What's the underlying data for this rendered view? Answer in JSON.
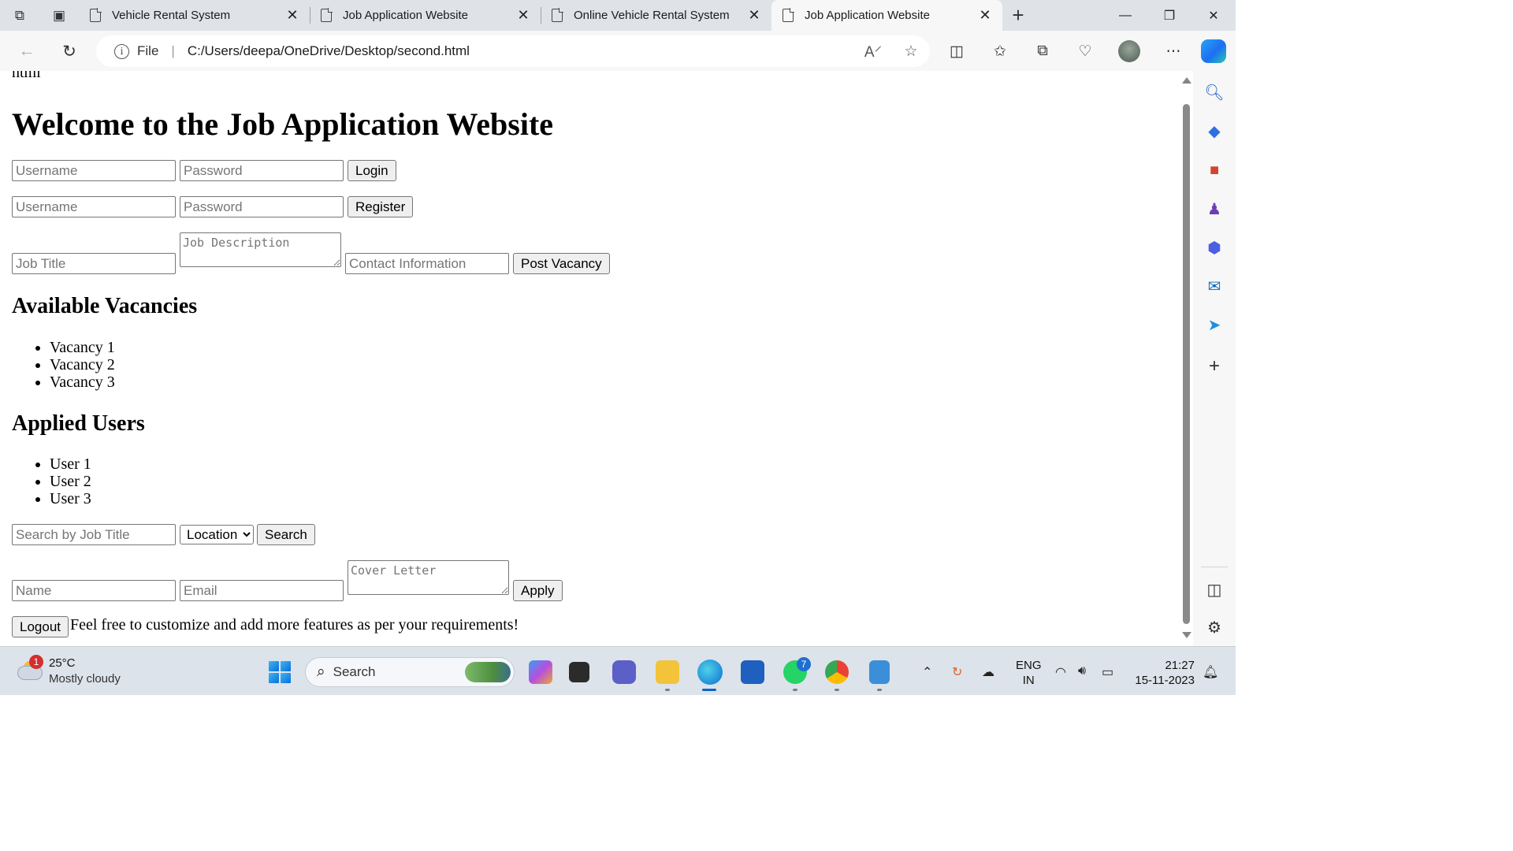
{
  "browser": {
    "tabs": [
      {
        "title": "Vehicle Rental System",
        "active": false
      },
      {
        "title": "Job Application Website",
        "active": false
      },
      {
        "title": "Online Vehicle Rental System",
        "active": false
      },
      {
        "title": "Job Application Website",
        "active": true
      }
    ],
    "address": {
      "scheme_label": "File",
      "url": "C:/Users/deepa/OneDrive/Desktop/second.html"
    },
    "icons": {
      "workspaces": "workspaces-icon",
      "tab_actions": "tab-actions-icon",
      "back": "back-arrow-icon",
      "refresh": "refresh-icon",
      "read_aloud": "read-aloud-icon",
      "favorite": "star-icon",
      "split": "split-screen-icon",
      "favorites": "favorites-icon",
      "collections": "collections-icon",
      "health": "browser-essentials-icon",
      "profile": "profile-avatar",
      "more": "more-icon",
      "copilot": "copilot-icon"
    }
  },
  "page": {
    "cut_text": "html",
    "heading": "Welcome to the Job Application Website",
    "login": {
      "username_placeholder": "Username",
      "password_placeholder": "Password",
      "button": "Login"
    },
    "register": {
      "username_placeholder": "Username",
      "password_placeholder": "Password",
      "button": "Register"
    },
    "post": {
      "job_title_placeholder": "Job Title",
      "description_placeholder": "Job Description",
      "contact_placeholder": "Contact Information",
      "button": "Post Vacancy"
    },
    "vacancies": {
      "heading": "Available Vacancies",
      "items": [
        "Vacancy 1",
        "Vacancy 2",
        "Vacancy 3"
      ]
    },
    "applied": {
      "heading": "Applied Users",
      "items": [
        "User 1",
        "User 2",
        "User 3"
      ]
    },
    "search": {
      "placeholder": "Search by Job Title",
      "location_selected": "Location",
      "button": "Search"
    },
    "apply": {
      "name_placeholder": "Name",
      "email_placeholder": "Email",
      "cover_placeholder": "Cover Letter",
      "button": "Apply"
    },
    "logout_button": "Logout",
    "footer_text": "Feel free to customize and add more features as per your requirements!"
  },
  "taskbar": {
    "weather": {
      "badge": "1",
      "temp": "25°C",
      "desc": "Mostly cloudy"
    },
    "search_label": "Search",
    "whatsapp_badge": "7",
    "lang_line1": "ENG",
    "lang_line2": "IN",
    "time": "21:27",
    "date": "15-11-2023"
  }
}
